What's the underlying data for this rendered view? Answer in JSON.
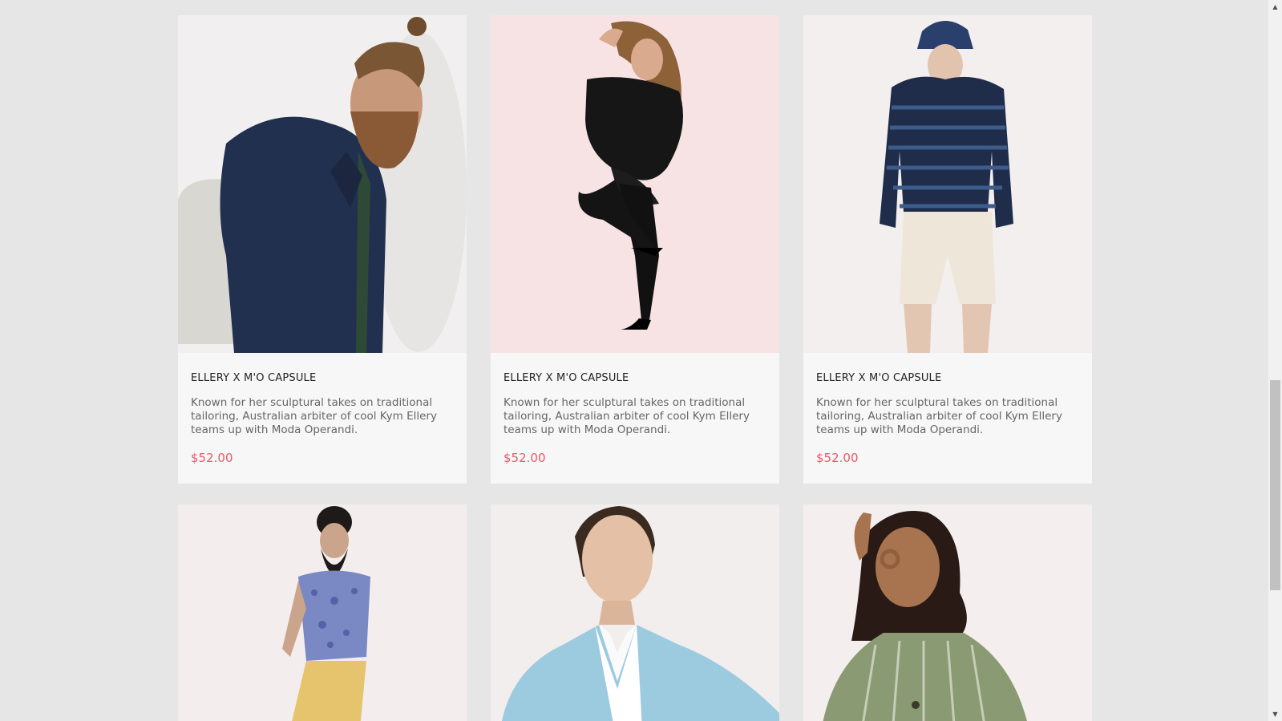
{
  "products": [
    {
      "title": "ELLERY X M'O CAPSULE",
      "description": "Known for her sculptural takes on traditional tailoring, Australian arbiter of cool Kym Ellery teams up with Moda Operandi.",
      "price": "$52.00",
      "image_bg": "#f1efef",
      "image_subject": "man-in-navy-puffer-jacket-with-backpack"
    },
    {
      "title": "ELLERY X M'O CAPSULE",
      "description": "Known for her sculptural takes on traditional tailoring, Australian arbiter of cool Kym Ellery teams up with Moda Operandi.",
      "price": "$52.00",
      "image_bg": "#f7e3e4",
      "image_subject": "woman-in-black-outfit-posing"
    },
    {
      "title": "ELLERY X M'O CAPSULE",
      "description": "Known for her sculptural takes on traditional tailoring, Australian arbiter of cool Kym Ellery teams up with Moda Operandi.",
      "price": "$52.00",
      "image_bg": "#f2efee",
      "image_subject": "man-in-striped-hoodie-and-bucket-hat"
    },
    {
      "image_bg": "#f3eded",
      "image_subject": "bearded-man-in-floral-shirt"
    },
    {
      "image_bg": "#f2eeee",
      "image_subject": "woman-in-light-blue-blazer"
    },
    {
      "image_bg": "#f4eeee",
      "image_subject": "woman-in-striped-green-top"
    }
  ],
  "colors": {
    "page_bg": "#e6e6e6",
    "card_bg": "#f7f7f7",
    "price": "#e8596a"
  }
}
